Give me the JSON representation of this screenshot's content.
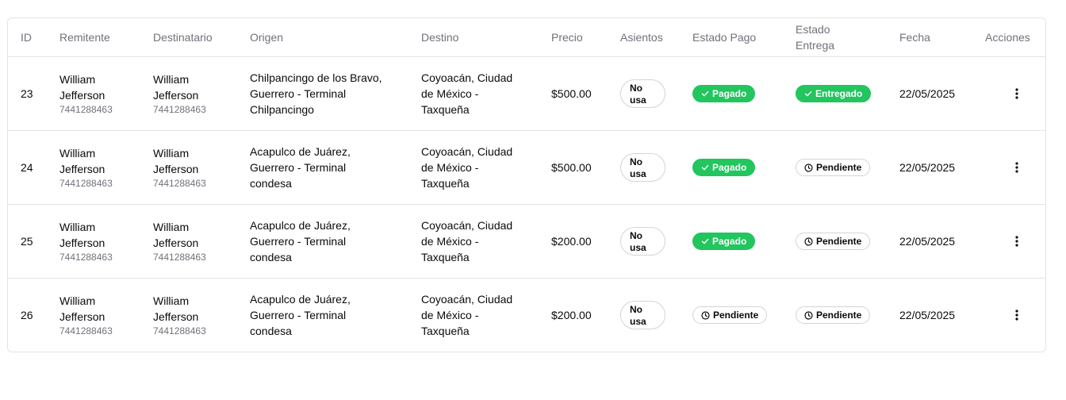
{
  "table": {
    "columns": {
      "id": "ID",
      "sender": "Remitente",
      "recipient": "Destinatario",
      "origin": "Origen",
      "destination": "Destino",
      "price": "Precio",
      "seats": "Asientos",
      "payment_status": "Estado Pago",
      "delivery_status_line1": "Estado",
      "delivery_status_line2": "Entrega",
      "date": "Fecha",
      "actions": "Acciones"
    },
    "rows": [
      {
        "id": "23",
        "sender_name_1": "William",
        "sender_name_2": "Jefferson",
        "sender_phone": "7441288463",
        "recipient_name_1": "William",
        "recipient_name_2": "Jefferson",
        "recipient_phone": "7441288463",
        "origin_1": "Chilpancingo de los Bravo,",
        "origin_2": "Guerrero - Terminal",
        "origin_3": "Chilpancingo",
        "destination_1": "Coyoacán, Ciudad",
        "destination_2": "de México -",
        "destination_3": "Taxqueña",
        "price": "$500.00",
        "seats_1": "No",
        "seats_2": "usa",
        "payment": "Pagado",
        "payment_state": "paid",
        "delivery": "Entregado",
        "delivery_state": "paid",
        "date": "22/05/2025"
      },
      {
        "id": "24",
        "sender_name_1": "William",
        "sender_name_2": "Jefferson",
        "sender_phone": "7441288463",
        "recipient_name_1": "William",
        "recipient_name_2": "Jefferson",
        "recipient_phone": "7441288463",
        "origin_1": "Acapulco de Juárez,",
        "origin_2": "Guerrero - Terminal",
        "origin_3": "condesa",
        "destination_1": "Coyoacán, Ciudad",
        "destination_2": "de México -",
        "destination_3": "Taxqueña",
        "price": "$500.00",
        "seats_1": "No",
        "seats_2": "usa",
        "payment": "Pagado",
        "payment_state": "paid",
        "delivery": "Pendiente",
        "delivery_state": "pending",
        "date": "22/05/2025"
      },
      {
        "id": "25",
        "sender_name_1": "William",
        "sender_name_2": "Jefferson",
        "sender_phone": "7441288463",
        "recipient_name_1": "William",
        "recipient_name_2": "Jefferson",
        "recipient_phone": "7441288463",
        "origin_1": "Acapulco de Juárez,",
        "origin_2": "Guerrero - Terminal",
        "origin_3": "condesa",
        "destination_1": "Coyoacán, Ciudad",
        "destination_2": "de México -",
        "destination_3": "Taxqueña",
        "price": "$200.00",
        "seats_1": "No",
        "seats_2": "usa",
        "payment": "Pagado",
        "payment_state": "paid",
        "delivery": "Pendiente",
        "delivery_state": "pending",
        "date": "22/05/2025"
      },
      {
        "id": "26",
        "sender_name_1": "William",
        "sender_name_2": "Jefferson",
        "sender_phone": "7441288463",
        "recipient_name_1": "William",
        "recipient_name_2": "Jefferson",
        "recipient_phone": "7441288463",
        "origin_1": "Acapulco de Juárez,",
        "origin_2": "Guerrero - Terminal",
        "origin_3": "condesa",
        "destination_1": "Coyoacán, Ciudad",
        "destination_2": "de México -",
        "destination_3": "Taxqueña",
        "price": "$200.00",
        "seats_1": "No",
        "seats_2": "usa",
        "payment": "Pendiente",
        "payment_state": "pending",
        "delivery": "Pendiente",
        "delivery_state": "pending",
        "date": "22/05/2025"
      }
    ]
  },
  "icons": {
    "paid": "check-icon",
    "pending": "clock-icon",
    "actions": "more-vertical-icon"
  },
  "colors": {
    "success": "#22c55e",
    "border": "#e4e4e7",
    "muted_text": "#71717a"
  }
}
